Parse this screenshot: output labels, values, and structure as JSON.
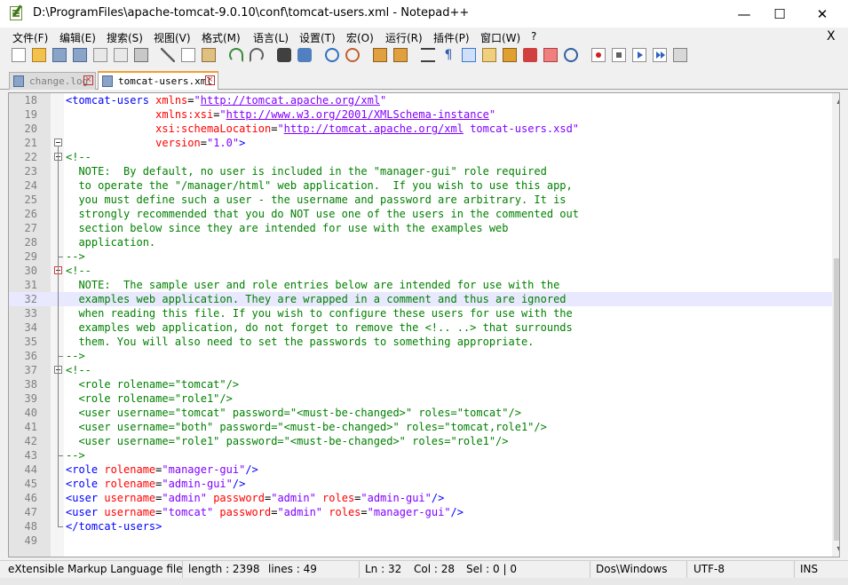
{
  "window": {
    "title": "D:\\ProgramFiles\\apache-tomcat-9.0.10\\conf\\tomcat-users.xml - Notepad++",
    "minimize": "—",
    "maximize": "☐",
    "close": "✕"
  },
  "menu": {
    "items": [
      "文件(F)",
      "编辑(E)",
      "搜索(S)",
      "视图(V)",
      "格式(M)",
      "语言(L)",
      "设置(T)",
      "宏(O)",
      "运行(R)",
      "插件(P)",
      "窗口(W)",
      "?"
    ],
    "close_doc": "X"
  },
  "tabs": [
    {
      "label": "change.log",
      "active": false,
      "close": "×"
    },
    {
      "label": "tomcat-users.xml",
      "active": true,
      "close": "×"
    }
  ],
  "editor": {
    "current_line": 32,
    "lines": [
      {
        "n": "18",
        "t": "<tomcat-users xmlns=\"http://tomcat.apache.org/xml\""
      },
      {
        "n": "19",
        "t": "              xmlns:xsi=\"http://www.w3.org/2001/XMLSchema-instance\""
      },
      {
        "n": "20",
        "t": "              xsi:schemaLocation=\"http://tomcat.apache.org/xml tomcat-users.xsd\""
      },
      {
        "n": "21",
        "t": "              version=\"1.0\">"
      },
      {
        "n": "22",
        "t": "<!--"
      },
      {
        "n": "23",
        "t": "  NOTE:  By default, no user is included in the \"manager-gui\" role required"
      },
      {
        "n": "24",
        "t": "  to operate the \"/manager/html\" web application.  If you wish to use this app,"
      },
      {
        "n": "25",
        "t": "  you must define such a user - the username and password are arbitrary. It is"
      },
      {
        "n": "26",
        "t": "  strongly recommended that you do NOT use one of the users in the commented out"
      },
      {
        "n": "27",
        "t": "  section below since they are intended for use with the examples web"
      },
      {
        "n": "28",
        "t": "  application."
      },
      {
        "n": "29",
        "t": "-->"
      },
      {
        "n": "30",
        "t": "<!--"
      },
      {
        "n": "31",
        "t": "  NOTE:  The sample user and role entries below are intended for use with the"
      },
      {
        "n": "32",
        "t": "  examples web application. They are wrapped in a comment and thus are ignored"
      },
      {
        "n": "33",
        "t": "  when reading this file. If you wish to configure these users for use with the"
      },
      {
        "n": "34",
        "t": "  examples web application, do not forget to remove the <!.. ..> that surrounds"
      },
      {
        "n": "35",
        "t": "  them. You will also need to set the passwords to something appropriate."
      },
      {
        "n": "36",
        "t": "-->"
      },
      {
        "n": "37",
        "t": "<!--"
      },
      {
        "n": "38",
        "t": "  <role rolename=\"tomcat\"/>"
      },
      {
        "n": "39",
        "t": "  <role rolename=\"role1\"/>"
      },
      {
        "n": "40",
        "t": "  <user username=\"tomcat\" password=\"<must-be-changed>\" roles=\"tomcat\"/>"
      },
      {
        "n": "41",
        "t": "  <user username=\"both\" password=\"<must-be-changed>\" roles=\"tomcat,role1\"/>"
      },
      {
        "n": "42",
        "t": "  <user username=\"role1\" password=\"<must-be-changed>\" roles=\"role1\"/>"
      },
      {
        "n": "43",
        "t": "-->"
      },
      {
        "n": "44",
        "t": "<role rolename=\"manager-gui\"/>"
      },
      {
        "n": "45",
        "t": "<role rolename=\"admin-gui\"/>"
      },
      {
        "n": "46",
        "t": "<user username=\"admin\" password=\"admin\" roles=\"admin-gui\"/>"
      },
      {
        "n": "47",
        "t": "<user username=\"tomcat\" password=\"admin\" roles=\"manager-gui\"/>"
      },
      {
        "n": "48",
        "t": "</tomcat-users>"
      },
      {
        "n": "49",
        "t": ""
      }
    ]
  },
  "status": {
    "file_type": "eXtensible Markup Language file",
    "length": "length : 2398",
    "lines": "lines : 49",
    "ln": "Ln : 32",
    "col": "Col : 28",
    "sel": "Sel : 0 | 0",
    "eol": "Dos\\Windows",
    "encoding": "UTF-8",
    "mode": "INS"
  },
  "colors": {
    "tag": "#0000ff",
    "attribute": "#ff0000",
    "value": "#8000ff",
    "comment": "#008000",
    "current_line_bg": "#e8e8ff"
  }
}
